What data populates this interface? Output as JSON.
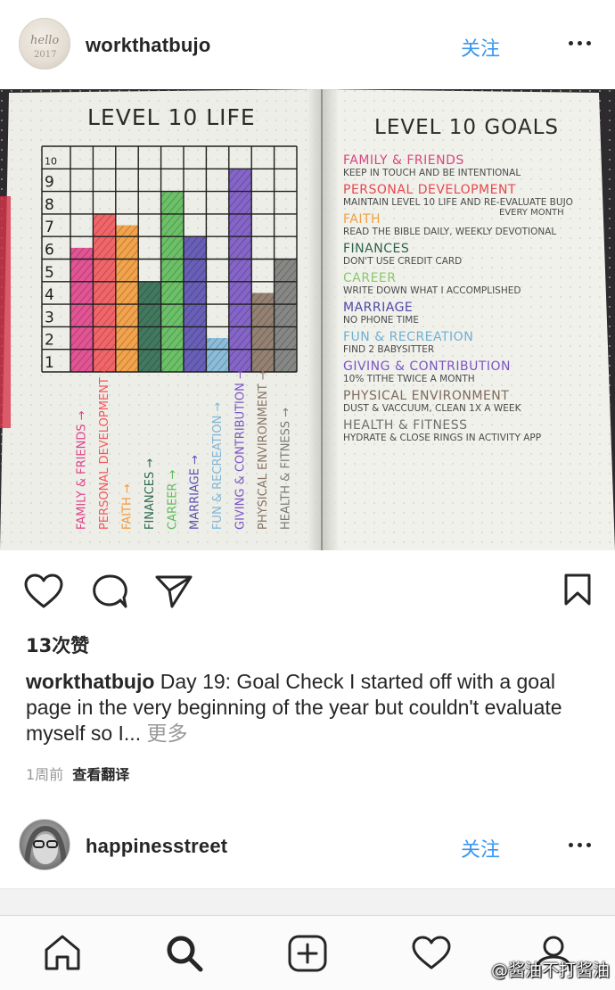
{
  "post": {
    "username": "workthatbujo",
    "follow_label": "关注",
    "avatar_text": "hello 2017",
    "likes": "13次赞",
    "caption_user": "workthatbujo",
    "caption_text": " Day 19: Goal Check I started off with a goal page in the very beginning of the year but couldn't evaluate myself so I... ",
    "more_label": "更多",
    "time_ago": "1周前",
    "translate_label": "查看翻译"
  },
  "photo": {
    "left_title": "Level 10 Life",
    "right_title": "Level 10 Goals",
    "chart_levels": [
      "1",
      "2",
      "3",
      "4",
      "5",
      "6",
      "7",
      "8",
      "9",
      "10"
    ],
    "chart_data": {
      "type": "bar",
      "title": "Level 10 Life",
      "categories": [
        "Family & Friends",
        "Personal Development",
        "Faith",
        "Finances",
        "Career",
        "Marriage",
        "Fun & Recreation",
        "Giving & Contribution",
        "Physical Environment",
        "Health & Fitness"
      ],
      "values": [
        5.5,
        7,
        6.5,
        4,
        8,
        6,
        1.5,
        9,
        3.5,
        5
      ],
      "colors": [
        "#e0428a",
        "#f2565b",
        "#f39a3b",
        "#2f6b4f",
        "#5dbb5a",
        "#5a4fb2",
        "#7fb6d8",
        "#7a55c5",
        "#8a7465",
        "#7b7b7b"
      ],
      "ylim": [
        0,
        10
      ]
    },
    "goals": [
      {
        "title": "Family & Friends",
        "line1": "Keep in touch and be intentional",
        "line2": "",
        "color": "#d8467f"
      },
      {
        "title": "Personal Development",
        "line1": "Maintain Level 10 Life and re-evaluate bujo",
        "line2": "every month",
        "color": "#e5484d"
      },
      {
        "title": "Faith",
        "line1": "Read the Bible daily, weekly devotional",
        "line2": "",
        "color": "#f0a043"
      },
      {
        "title": "Finances",
        "line1": "Don't use credit card",
        "line2": "",
        "color": "#2f6150"
      },
      {
        "title": "Career",
        "line1": "Write down what I accomplished",
        "line2": "",
        "color": "#8cc76f"
      },
      {
        "title": "Marriage",
        "line1": "No phone time",
        "line2": "",
        "color": "#4f46a8"
      },
      {
        "title": "Fun & Recreation",
        "line1": "Find 2 babysitter",
        "line2": "",
        "color": "#6fb0d3"
      },
      {
        "title": "Giving & Contribution",
        "line1": "10% tithe twice a month",
        "line2": "",
        "color": "#7a55c5"
      },
      {
        "title": "Physical Environment",
        "line1": "Dust & vaccuum, clean 1x a week",
        "line2": "",
        "color": "#7e6a5c"
      },
      {
        "title": "Health & Fitness",
        "line1": "Hydrate & close rings in activity app",
        "line2": "",
        "color": "#6f6f6f"
      }
    ]
  },
  "next_post": {
    "username": "happinesstreet",
    "follow_label": "关注"
  },
  "tabs": [
    "home-tab",
    "search-tab",
    "add-post-tab",
    "activity-tab",
    "profile-tab"
  ],
  "watermark": "@酱油不打酱油"
}
